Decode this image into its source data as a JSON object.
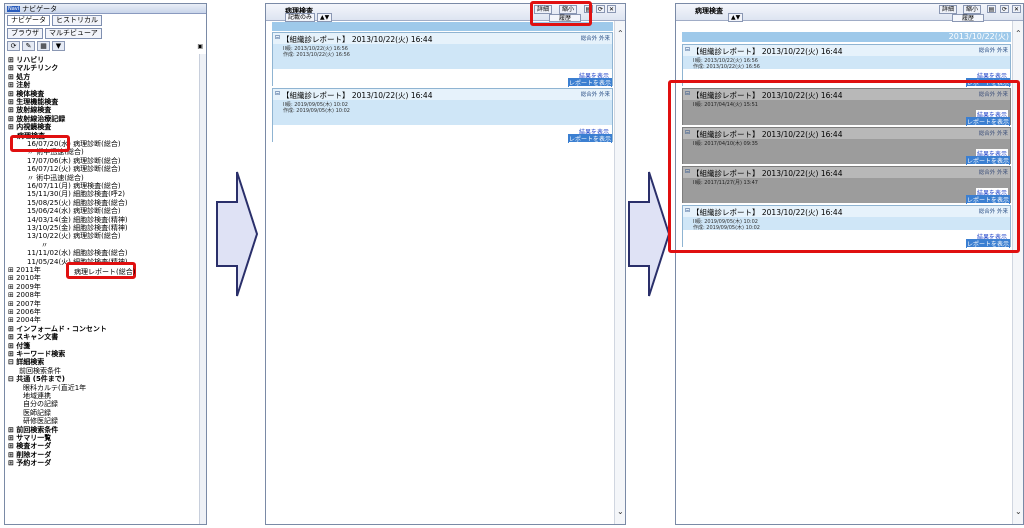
{
  "navigator": {
    "title": "ナビゲータ",
    "logo": "Navi",
    "tabs": [
      "ナビゲータ",
      "ヒストリカル",
      "ブラウザ",
      "マルチビューア"
    ],
    "tree": [
      {
        "label": "⊞ リハビリ",
        "bold": true
      },
      {
        "label": "⊞ マルチリンク",
        "bold": true
      },
      {
        "label": "⊞ 処方",
        "bold": true
      },
      {
        "label": "⊞ 注射",
        "bold": true
      },
      {
        "label": "⊞ 検体検査",
        "bold": true
      },
      {
        "label": "⊞ 生理機能検査",
        "bold": true
      },
      {
        "label": "⊞ 放射線検査",
        "bold": true
      },
      {
        "label": "⊞ 放射線治療記録",
        "bold": true
      },
      {
        "label": "⊞ 内視鏡検査",
        "bold": true
      },
      {
        "label": "病理検査",
        "bold": true
      },
      {
        "label": "16/07/20(水) 病理診断(総合)",
        "bold": false
      },
      {
        "label": "〃        術中迅速(総合)",
        "bold": false
      },
      {
        "label": "17/07/06(木) 病理診断(総合)",
        "bold": false
      },
      {
        "label": "16/07/12(火) 病理診断(総合)",
        "bold": false
      },
      {
        "label": "〃        術中迅速(総合)",
        "bold": false
      },
      {
        "label": "16/07/11(月) 病理検査(総合)",
        "bold": false
      },
      {
        "label": "15/11/30(月) 細胞診検査(呼2)",
        "bold": false
      },
      {
        "label": "15/08/25(火) 細胞診検査(総合)",
        "bold": false
      },
      {
        "label": "15/06/24(水) 病理診断(総合)",
        "bold": false
      },
      {
        "label": "14/03/14(金) 細胞診検査(精神)",
        "bold": false
      },
      {
        "label": "13/10/25(金) 細胞診検査(精神)",
        "bold": false
      },
      {
        "label": "13/10/22(火) 病理診断(総合)",
        "bold": false
      },
      {
        "label": "〃",
        "bold": false
      },
      {
        "label": "11/11/02(水) 細胞診検査(総合)",
        "bold": false
      },
      {
        "label": "11/05/24(火) 細胞診検査(精神)",
        "bold": false
      },
      {
        "label": "⊞ 2011年",
        "bold": false
      },
      {
        "label": "⊞ 2010年",
        "bold": false
      },
      {
        "label": "⊞ 2009年",
        "bold": false
      },
      {
        "label": "⊞ 2008年",
        "bold": false
      },
      {
        "label": "⊞ 2007年",
        "bold": false
      },
      {
        "label": "⊞ 2006年",
        "bold": false
      },
      {
        "label": "⊞ 2004年",
        "bold": false
      },
      {
        "label": "⊞ インフォームド・コンセント",
        "bold": true
      },
      {
        "label": "⊞ スキャン文書",
        "bold": true
      },
      {
        "label": "⊞ 付箋",
        "bold": true
      },
      {
        "label": "⊞ キーワード検索",
        "bold": true
      },
      {
        "label": "⊟ 詳細検索",
        "bold": true
      },
      {
        "label": "前回検索条件",
        "bold": false
      },
      {
        "label": "⊟ 共通 (5件まで)",
        "bold": true
      },
      {
        "label": "眼科カルテ(直近1年",
        "bold": false
      },
      {
        "label": "地域連携",
        "bold": false
      },
      {
        "label": "自分の記録",
        "bold": false
      },
      {
        "label": "医師記録",
        "bold": false
      },
      {
        "label": "研修医記録",
        "bold": false
      },
      {
        "label": "⊞ 前回検索条件",
        "bold": true
      },
      {
        "label": "⊞ サマリ一覧",
        "bold": true
      },
      {
        "label": "⊞ 検査オーダ",
        "bold": true
      },
      {
        "label": "⊞ 削除オーダ",
        "bold": true
      },
      {
        "label": "⊞ 予約オーダ",
        "bold": true
      }
    ],
    "callout": "病理レポート(総合)"
  },
  "panel_middle": {
    "title": "病理検査",
    "filter": "記載のみ",
    "detail": "詳細",
    "shrink": "縮小",
    "history": "履歴",
    "cards": [
      {
        "title": "【組織診レポート】 2013/10/22(火) 16:44",
        "tags": "総合外  外来",
        "d1": "II級: 2013/10/22(火) 16:56",
        "d2": "作成: 2013/10/22(火) 16:56",
        "link1": "結果を表示",
        "link2": "レポートを表示"
      },
      {
        "title": "【組織診レポート】 2013/10/22(火) 16:44",
        "tags": "総合外  外来",
        "d1": "II級: 2019/09/05(木) 10:02",
        "d2": "作成: 2019/09/05(木) 10:02",
        "link1": "結果を表示",
        "link2": "レポートを表示"
      }
    ]
  },
  "panel_right": {
    "title": "病理検査",
    "detail": "詳細",
    "shrink": "縮小",
    "history": "履歴",
    "header_date": "2013/10/22(火)",
    "cards": [
      {
        "title": "【組織診レポート】 2013/10/22(火) 16:44",
        "tags": "総合外  外来",
        "d1": "II級: 2013/10/22(火) 16:56",
        "d2": "作成: 2013/10/22(火) 16:56",
        "link1": "結果を表示",
        "link2": "レポートを表示",
        "gray": false
      },
      {
        "title": "【組織診レポート】 2013/10/22(火) 16:44",
        "tags": "総合外  外来",
        "d1": "II級: 2017/04/14(火) 15:51",
        "d2": "",
        "link1": "結果を表示",
        "link2": "レポートを表示",
        "gray": true
      },
      {
        "title": "【組織診レポート】 2013/10/22(火) 16:44",
        "tags": "総合外  外来",
        "d1": "II級: 2017/04/10(木) 09:35",
        "d2": "",
        "link1": "結果を表示",
        "link2": "レポートを表示",
        "gray": true
      },
      {
        "title": "【組織診レポート】 2013/10/22(火) 16:44",
        "tags": "総合外  外来",
        "d1": "II級: 2017/11/27(月) 13:47",
        "d2": "",
        "link1": "結果を表示",
        "link2": "レポートを表示",
        "gray": true
      },
      {
        "title": "【組織診レポート】 2013/10/22(火) 16:44",
        "tags": "総合外  外来",
        "d1": "II級: 2019/09/05(木) 10:02",
        "d2": "作成: 2019/09/05(木) 10:02",
        "link1": "結果を表示",
        "link2": "レポートを表示",
        "gray": false
      }
    ]
  },
  "colors": {
    "highlight": "#e01010",
    "arrow_fill": "#dfe2f5",
    "arrow_stroke": "#2a2f6a",
    "card_blue": "#cfe6f7",
    "card_gray": "#9c9c9c"
  }
}
